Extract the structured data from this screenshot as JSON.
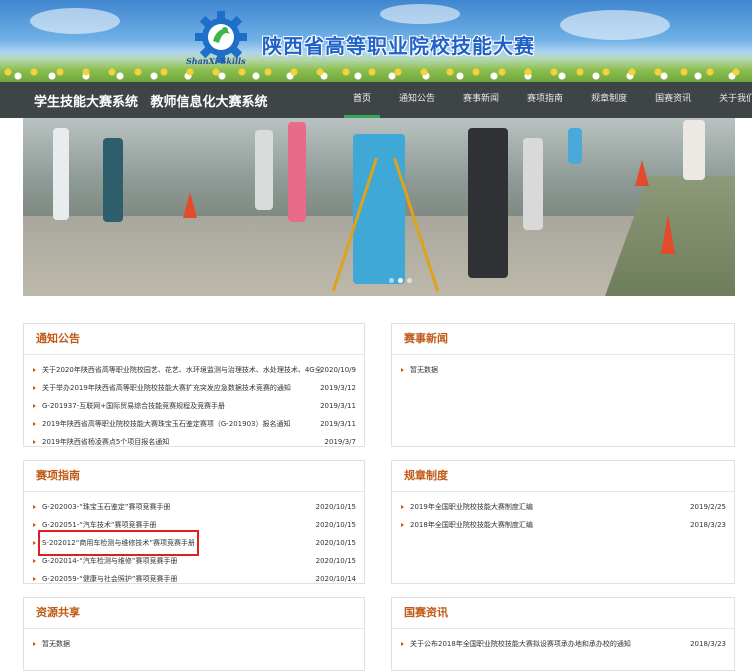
{
  "header": {
    "logo_text": "ShanXi Skills",
    "site_title": "陕西省高等职业院校技能大赛"
  },
  "nav": {
    "systems": [
      "学生技能大赛系统",
      "教师信息化大赛系统"
    ],
    "menu": [
      "首页",
      "通知公告",
      "赛事新闻",
      "赛项指南",
      "规章制度",
      "国赛资讯",
      "关于我们"
    ],
    "active_index": 0
  },
  "hero": {
    "slide_count": 3,
    "active_slide": 1
  },
  "panels": {
    "notices": {
      "title": "通知公告",
      "items": [
        {
          "text": "关于2020年陕西省高等职业院校园艺、花艺、水环境监测与治理技术、水处理技术、4G全",
          "date": "2020/10/9"
        },
        {
          "text": "关于举办2019年陕西省高等职业院校技能大赛扩充突发应急数据技术竞赛的通知",
          "date": "2019/3/12"
        },
        {
          "text": "G-201937-互联网+国际贸易综合技能竞赛规程及竞赛手册",
          "date": "2019/3/11"
        },
        {
          "text": "2019年陕西省高等职业院校技能大赛珠宝玉石鉴定赛项（G-201903）报名通知",
          "date": "2019/3/11"
        },
        {
          "text": "2019年陕西省杨凌赛点5个项目报名通知",
          "date": "2019/3/7"
        }
      ]
    },
    "news": {
      "title": "赛事新闻",
      "items": [
        {
          "text": "暂无数据",
          "date": ""
        }
      ]
    },
    "guide": {
      "title": "赛项指南",
      "highlight_index": 2,
      "items": [
        {
          "text": "G-202003-“珠宝玉石鉴定”赛项竞赛手册",
          "date": "2020/10/15"
        },
        {
          "text": "G-202051-“汽车技术”赛项竞赛手册",
          "date": "2020/10/15"
        },
        {
          "text": "S-202012“商用车检测与维修技术”赛项竞赛手册",
          "date": "2020/10/15"
        },
        {
          "text": "G-202014-“汽车检测与维修”赛项竞赛手册",
          "date": "2020/10/15"
        },
        {
          "text": "G-202059-“健康与社会照护”赛项竞赛手册",
          "date": "2020/10/14"
        }
      ]
    },
    "rules": {
      "title": "规章制度",
      "items": [
        {
          "text": "2019年全国职业院校技能大赛制度汇编",
          "date": "2019/2/25"
        },
        {
          "text": "2018年全国职业院校技能大赛制度汇编",
          "date": "2018/3/23"
        }
      ]
    },
    "resources": {
      "title": "资源共享",
      "items": [
        {
          "text": "暂无数据",
          "date": ""
        }
      ]
    },
    "national": {
      "title": "国赛资讯",
      "items": [
        {
          "text": "关于公布2018年全国职业院校技能大赛拟设赛项承办地和承办校的通知",
          "date": "2018/3/23"
        }
      ]
    }
  },
  "colors": {
    "nav_bg": "#3f4547",
    "accent_green": "#3aa55a",
    "heading_orange": "#c05a18",
    "title_blue": "#1f62c9",
    "highlight_red": "#e02020"
  }
}
